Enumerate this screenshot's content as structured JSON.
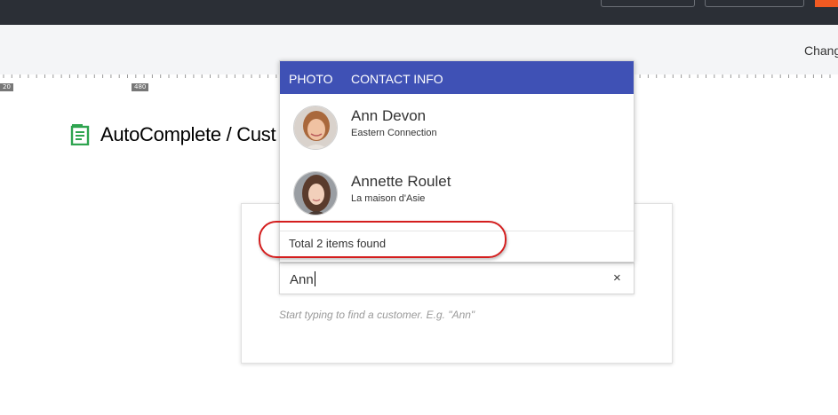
{
  "toolbar": {
    "change_label": "Chang"
  },
  "ruler": {
    "labels": [
      "20",
      "480"
    ]
  },
  "page": {
    "title": "AutoComplete / Cust",
    "hint": "Start typing to find a customer. E.g. \"Ann\""
  },
  "search": {
    "value": "Ann"
  },
  "popup": {
    "header_photo": "PHOTO",
    "header_contact": "CONTACT INFO",
    "items": [
      {
        "name": "Ann Devon",
        "company": "Eastern Connection"
      },
      {
        "name": "Annette Roulet",
        "company": "La maison d'Asie"
      }
    ],
    "footer": "Total 2 items found"
  },
  "icons": {
    "clear": "×",
    "page": "document-icon"
  },
  "colors": {
    "header_bg": "#3f51b5",
    "highlight": "#d41e1e",
    "icon_green": "#2ea44f",
    "accent": "#f15a22"
  }
}
